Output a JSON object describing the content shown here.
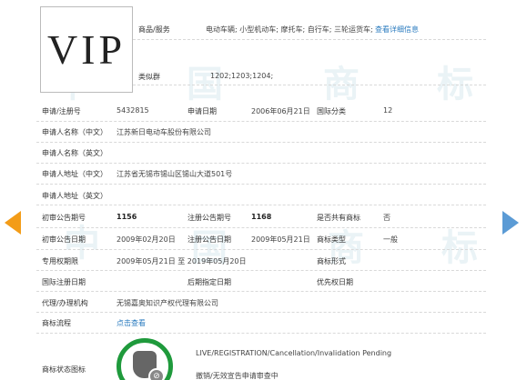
{
  "logo_text": "VIP",
  "goods": {
    "label": "商品/服务",
    "value": "电动车辆; 小型机动车; 摩托车; 自行车; 三轮运货车;",
    "link": "查看详细信息"
  },
  "similar": {
    "label": "类似群",
    "value": "1202;1203;1204;"
  },
  "row_app": {
    "label1": "申请/注册号",
    "value1": "5432815",
    "label2": "申请日期",
    "value2": "2006年06月21日",
    "label3": "国际分类",
    "value3": "12"
  },
  "applicant_cn": {
    "label": "申请人名称（中文）",
    "value": "江苏新日电动车股份有限公司"
  },
  "applicant_en": {
    "label": "申请人名称（英文）",
    "value": ""
  },
  "address_cn": {
    "label": "申请人地址（中文）",
    "value": "江苏省无锡市锡山区锡山大道501号"
  },
  "address_en": {
    "label": "申请人地址（英文）",
    "value": ""
  },
  "row_pub": {
    "label1": "初审公告期号",
    "value1": "1156",
    "label2": "注册公告期号",
    "value2": "1168",
    "label3": "是否共有商标",
    "value3": "否"
  },
  "row_pubdate": {
    "label1": "初审公告日期",
    "value1": "2009年02月20日",
    "label2": "注册公告日期",
    "value2": "2009年05月21日",
    "label3": "商标类型",
    "value3": "一般"
  },
  "row_term": {
    "label1": "专用权期限",
    "value1": "2009年05月21日 至 2019年05月20日",
    "label3": "商标形式",
    "value3": ""
  },
  "row_intl": {
    "label1": "国际注册日期",
    "value1": "",
    "label2": "后期指定日期",
    "value2": "",
    "label3": "优先权日期",
    "value3": ""
  },
  "agent": {
    "label": "代理/办理机构",
    "value": "无锡嘉奥知识产权代理有限公司"
  },
  "process": {
    "label": "商标流程",
    "link": "点击查看"
  },
  "status": {
    "label": "商标状态图标",
    "line1": "LIVE/REGISTRATION/Cancellation/Invalidation Pending",
    "line2": "撤销/无效宣告申请审查中"
  },
  "watermark": [
    "中",
    "国",
    "商",
    "标"
  ],
  "colors": {
    "prev_arrow": "#f39c18",
    "next_arrow": "#5b9bd5",
    "link": "#2a7bbf",
    "status_ring": "#1f9a3c"
  },
  "icons": {
    "prev": "prev-arrow-icon",
    "next": "next-arrow-icon",
    "status": "status-seal-icon"
  }
}
